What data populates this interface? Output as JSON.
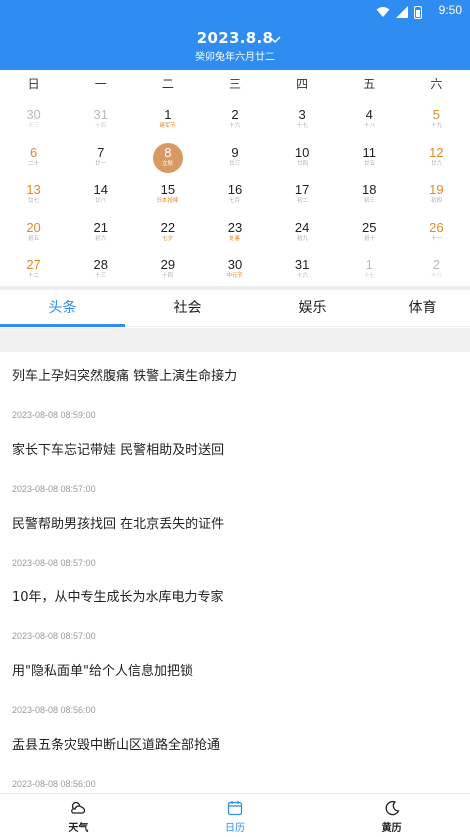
{
  "status": {
    "time": "9:50"
  },
  "header": {
    "date": "2023.8.8",
    "lunar": "癸卯兔年六月廿二"
  },
  "weekdays": [
    "日",
    "一",
    "二",
    "三",
    "四",
    "五",
    "六"
  ],
  "calendar": [
    [
      {
        "n": "30",
        "s": "十三",
        "t": "other"
      },
      {
        "n": "31",
        "s": "十四",
        "t": "other"
      },
      {
        "n": "1",
        "s": "建军节",
        "t": "holiday"
      },
      {
        "n": "2",
        "s": "十六",
        "t": ""
      },
      {
        "n": "3",
        "s": "十七",
        "t": ""
      },
      {
        "n": "4",
        "s": "十八",
        "t": ""
      },
      {
        "n": "5",
        "s": "十九",
        "t": "weekend"
      }
    ],
    [
      {
        "n": "6",
        "s": "二十",
        "t": "weekend"
      },
      {
        "n": "7",
        "s": "廿一",
        "t": ""
      },
      {
        "n": "8",
        "s": "立秋",
        "t": "selected"
      },
      {
        "n": "9",
        "s": "廿三",
        "t": ""
      },
      {
        "n": "10",
        "s": "廿四",
        "t": ""
      },
      {
        "n": "11",
        "s": "廿五",
        "t": ""
      },
      {
        "n": "12",
        "s": "廿六",
        "t": "weekend"
      }
    ],
    [
      {
        "n": "13",
        "s": "廿七",
        "t": "weekend"
      },
      {
        "n": "14",
        "s": "廿八",
        "t": ""
      },
      {
        "n": "15",
        "s": "日本投降",
        "t": "holiday"
      },
      {
        "n": "16",
        "s": "七月",
        "t": ""
      },
      {
        "n": "17",
        "s": "初二",
        "t": ""
      },
      {
        "n": "18",
        "s": "初三",
        "t": ""
      },
      {
        "n": "19",
        "s": "初四",
        "t": "weekend"
      }
    ],
    [
      {
        "n": "20",
        "s": "初五",
        "t": "weekend"
      },
      {
        "n": "21",
        "s": "初六",
        "t": ""
      },
      {
        "n": "22",
        "s": "七夕",
        "t": "holiday"
      },
      {
        "n": "23",
        "s": "处暑",
        "t": "holiday"
      },
      {
        "n": "24",
        "s": "初九",
        "t": ""
      },
      {
        "n": "25",
        "s": "初十",
        "t": ""
      },
      {
        "n": "26",
        "s": "十一",
        "t": "weekend"
      }
    ],
    [
      {
        "n": "27",
        "s": "十二",
        "t": "weekend"
      },
      {
        "n": "28",
        "s": "十三",
        "t": ""
      },
      {
        "n": "29",
        "s": "十四",
        "t": ""
      },
      {
        "n": "30",
        "s": "中元节",
        "t": "holiday"
      },
      {
        "n": "31",
        "s": "十六",
        "t": ""
      },
      {
        "n": "1",
        "s": "十七",
        "t": "other"
      },
      {
        "n": "2",
        "s": "十八",
        "t": "other"
      }
    ]
  ],
  "tabs": [
    "头条",
    "社会",
    "娱乐",
    "体育"
  ],
  "news": [
    {
      "title": "列车上孕妇突然腹痛 铁警上演生命接力",
      "time": "2023-08-08 08:59:00"
    },
    {
      "title": "家长下车忘记带娃 民警相助及时送回",
      "time": "2023-08-08 08:57:00"
    },
    {
      "title": "民警帮助男孩找回 在北京丢失的证件",
      "time": "2023-08-08 08:57:00"
    },
    {
      "title": "10年，从中专生成长为水库电力专家",
      "time": "2023-08-08 08:57:00"
    },
    {
      "title": "用\"隐私面单\"给个人信息加把锁",
      "time": "2023-08-08 08:56:00"
    },
    {
      "title": "盂县五条灾毁中断山区道路全部抢通",
      "time": "2023-08-08 08:56:00"
    }
  ],
  "nav": {
    "weather": "天气",
    "calendar": "日历",
    "almanac": "黄历"
  },
  "colors": {
    "primary": "#2f8cf0",
    "weekend": "#e0892c",
    "selected": "#d79a63"
  }
}
